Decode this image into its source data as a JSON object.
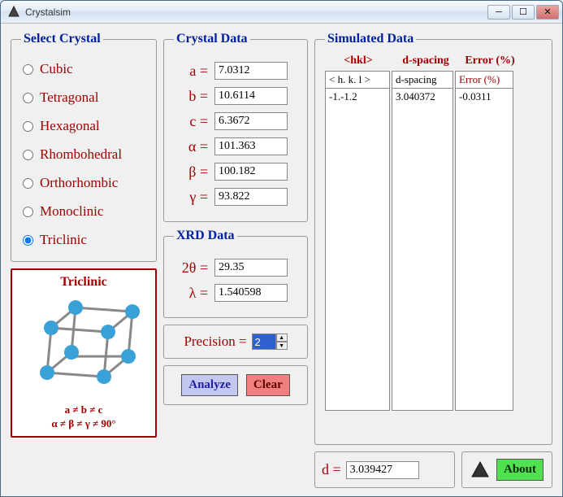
{
  "window": {
    "title": "Crystalsim"
  },
  "select_crystal": {
    "legend": "Select Crystal",
    "options": [
      "Cubic",
      "Tetragonal",
      "Hexagonal",
      "Rhombohedral",
      "Orthorhombic",
      "Monoclinic",
      "Triclinic"
    ],
    "selected": "Triclinic"
  },
  "crystal_data": {
    "legend": "Crystal Data",
    "a_label": "a =",
    "a": "7.0312",
    "b_label": "b =",
    "b": "10.6114",
    "c_label": "c =",
    "c": "6.3672",
    "alpha_label": "α =",
    "alpha": "101.363",
    "beta_label": "β =",
    "beta": "100.182",
    "gamma_label": "γ =",
    "gamma": "93.822"
  },
  "xrd_data": {
    "legend": "XRD Data",
    "two_theta_label": "2θ =",
    "two_theta": "29.35",
    "lambda_label": "λ =",
    "lambda": "1.540598"
  },
  "precision": {
    "label": "Precision =",
    "value": "2"
  },
  "buttons": {
    "analyze": "Analyze",
    "clear": "Clear",
    "about": "About"
  },
  "simulated": {
    "legend": "Simulated Data",
    "header_hkl": "<hkl>",
    "header_d": "d-spacing",
    "header_err": "Error (%)",
    "th_hkl": "< h. k. l >",
    "th_d": "d-spacing",
    "th_err": "Error (%)",
    "rows": [
      {
        "hkl": "-1.-1.2",
        "d": "3.040372",
        "err": "-0.0311"
      }
    ]
  },
  "d_result": {
    "label": "d =",
    "value": "3.039427"
  },
  "preview": {
    "title": "Triclinic",
    "formula1": "a ≠ b ≠ c",
    "formula2": "α ≠ β ≠ γ ≠ 90°"
  }
}
